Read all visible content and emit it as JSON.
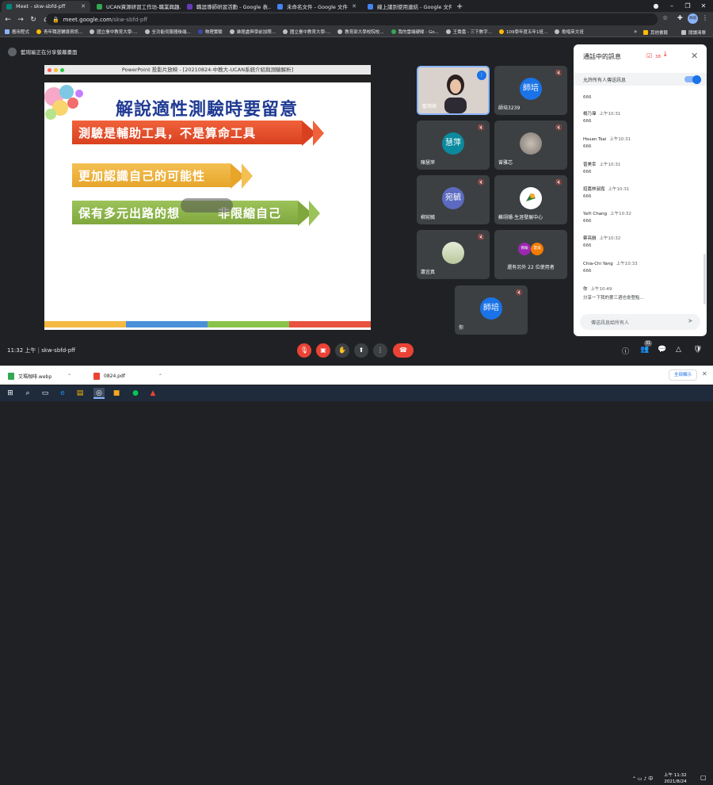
{
  "browser": {
    "tabs": [
      {
        "label": "Meet - skw-sbfd-pff",
        "color": "#00897b",
        "active": true
      },
      {
        "label": "UCAN資源研習工作坊-職業興趣...",
        "color": "#34a853"
      },
      {
        "label": "職涯導師研習活動 - Google 表...",
        "color": "#673ab7"
      },
      {
        "label": "未命名文件 - Google 文件",
        "color": "#4285f4"
      },
      {
        "label": "線上議到使用連結 - Google 文件",
        "color": "#4285f4"
      }
    ],
    "new_tab": "+",
    "url_host": "meet.google.com",
    "url_path": "/skw-sbfd-pff",
    "profile": "師培",
    "bookmarks": [
      "應用程式",
      "青年職涯輔導資訊...",
      "國立臺中教育大學-...",
      "全功能伺服器後端...",
      "物理實驗",
      "維館處與學前加照...",
      "國立臺中教育大學-...",
      "教育部大學校院校...",
      "我的雲端硬碟 - Go...",
      "王喬嘉 - 三下數字...",
      "109學年度五年1班...",
      "歌唱英文班"
    ],
    "bookmarks_more": "»",
    "bookmarks_other": "其他書籤",
    "reading_list": "閱讀清單"
  },
  "meet": {
    "present_banner": "藍琬瑜正在分享螢幕畫面",
    "presentation_title": "PowerPoint 投影片放映 - [20210824-中教大-UCAN系統介紹與測驗解析]",
    "slide": {
      "heading": "解說適性測驗時要留意",
      "bullets": [
        "測驗是輔助工具，不是算命工具",
        "更加認識自己的可能性",
        "保有多元出路的想　　　非限縮自己"
      ]
    },
    "participants": [
      {
        "name": "藍琬瑜",
        "initial": "",
        "avatar_color": "#b0b0b0",
        "speaking": true
      },
      {
        "name": "師培3239",
        "initial": "師培",
        "avatar_color": "#1a73e8"
      },
      {
        "name": "陳慧萍",
        "initial": "慧萍",
        "avatar_color": "#0b8a9e"
      },
      {
        "name": "曾雅芯",
        "initial": "",
        "avatar_color": "#9a8f87"
      },
      {
        "name": "柳宛毓",
        "initial": "宛毓",
        "avatar_color": "#5c6bc0"
      },
      {
        "name": "蘇翊珊-生涯發展中心",
        "initial": "",
        "avatar_color": "#ffffff"
      },
      {
        "name": "蕭宜真",
        "initial": "",
        "avatar_color": "#cdd9b8"
      },
      {
        "name": "還有另外 22 位使用者",
        "initial": "",
        "avatar_color": "#3c4043"
      },
      {
        "name": "你",
        "initial": "師培",
        "avatar_color": "#1a73e8"
      }
    ],
    "more_avatars": [
      "佩翰",
      "慧濱"
    ],
    "clock": "11:32 上午",
    "meeting_code": "skw-sbfd-pff",
    "participant_count": "31"
  },
  "chat": {
    "title": "通話中的訊息",
    "badge_count": "38",
    "toggle_label": "允許所有人傳送訊息",
    "messages": [
      {
        "who": "",
        "time": "",
        "text": "666"
      },
      {
        "who": "楊乃瑋",
        "time": "上午10:31",
        "text": "666"
      },
      {
        "who": "Hsuan Tsai",
        "time": "上午10:31",
        "text": "666"
      },
      {
        "who": "曾美幸",
        "time": "上午10:31",
        "text": "666"
      },
      {
        "who": "招嘉林淑霞",
        "time": "上午10:31",
        "text": "666"
      },
      {
        "who": "YaYi Chang",
        "time": "上午10:32",
        "text": "666"
      },
      {
        "who": "蔡亮融",
        "time": "上午10:32",
        "text": "666"
      },
      {
        "who": "Chia-Chi Yang",
        "time": "上午10:33",
        "text": "666"
      },
      {
        "who": "你",
        "time": "上午10:49",
        "text": "分享一下我的第三週也會登點..."
      }
    ],
    "input_placeholder": "傳送訊息給所有人"
  },
  "downloads": {
    "items": [
      "艾瑪咖啡.webp",
      "0824.pdf"
    ],
    "show_all": "全部顯示"
  },
  "taskbar": {
    "time": "上午 11:32",
    "date": "2021/8/24"
  }
}
